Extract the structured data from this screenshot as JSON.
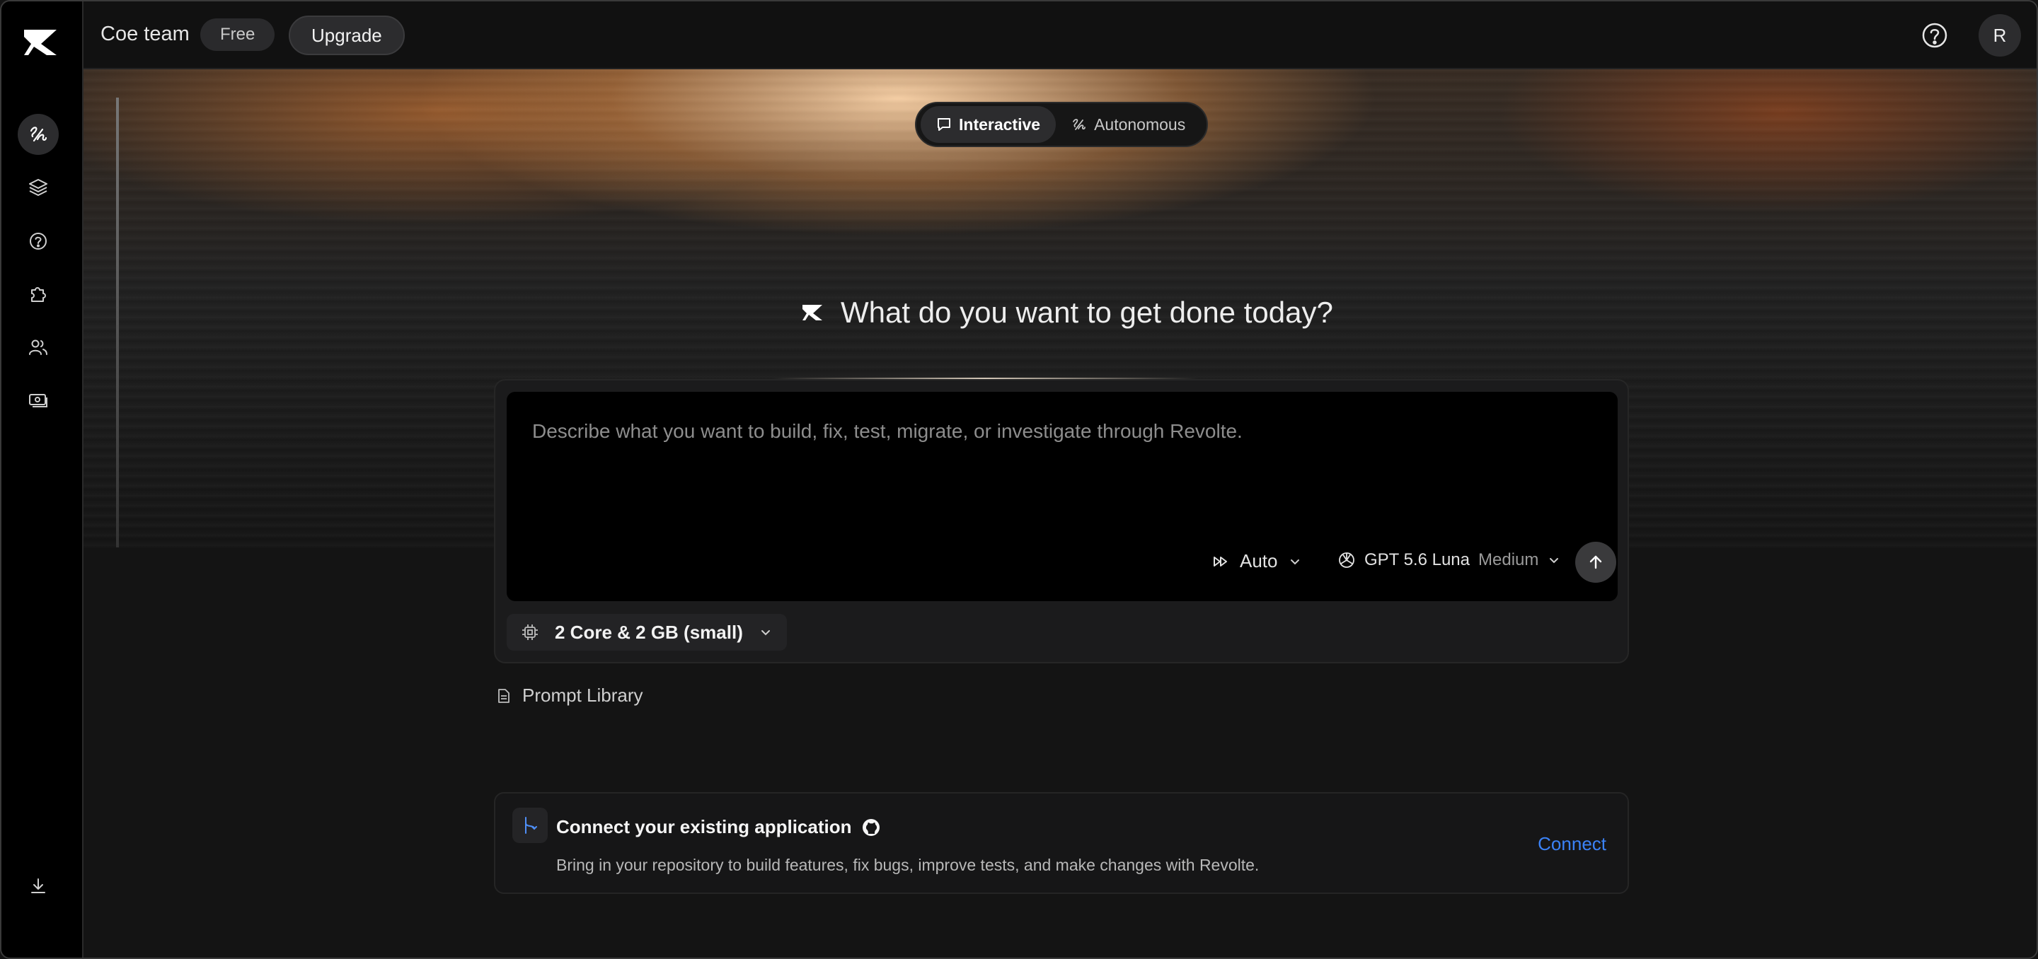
{
  "topbar": {
    "team_name": "Coe team",
    "plan_badge": "Free",
    "upgrade_label": "Upgrade",
    "avatar_initial": "R"
  },
  "sidebar": {
    "items": [
      {
        "icon": "tasks-icon",
        "active": true
      },
      {
        "icon": "layers-icon",
        "active": false
      },
      {
        "icon": "help-circle-icon",
        "active": false
      },
      {
        "icon": "puzzle-icon",
        "active": false
      },
      {
        "icon": "users-icon",
        "active": false
      },
      {
        "icon": "billing-icon",
        "active": false
      }
    ],
    "bottom_icon": "download-icon"
  },
  "mode_toggle": {
    "interactive_label": "Interactive",
    "autonomous_label": "Autonomous",
    "selected": "Interactive"
  },
  "hero": {
    "heading": "What do you want to get done today?"
  },
  "composer": {
    "placeholder": "Describe what you want to build, fix, test, migrate, or investigate through Revolte.",
    "value": "",
    "mode_label": "Auto",
    "model_name": "GPT 5.6 Luna",
    "model_level": "Medium",
    "machine_size": "2 Core & 2 GB (small)"
  },
  "prompt_library": {
    "label": "Prompt Library"
  },
  "connect_card": {
    "title": "Connect your existing application",
    "description": "Bring in your repository to build features, fix bugs, improve tests, and make changes with Revolte.",
    "button_label": "Connect"
  },
  "colors": {
    "accent_link": "#3b82f6",
    "background": "#141414",
    "sidebar": "#000000"
  }
}
